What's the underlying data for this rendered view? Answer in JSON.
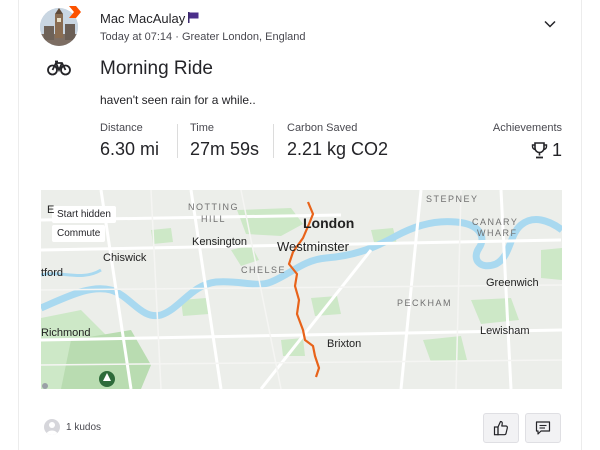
{
  "athlete": {
    "name": "Mac MacAulay",
    "timestamp": "Today at 07:14",
    "location": "Greater London, England",
    "meta_separator": " · "
  },
  "activity": {
    "type_icon": "bike-icon",
    "title": "Morning Ride",
    "description": "haven't seen rain for a while..",
    "stats": [
      {
        "label": "Distance",
        "value": "6.30 mi"
      },
      {
        "label": "Time",
        "value": "27m 59s"
      },
      {
        "label": "Carbon Saved",
        "value": "2.21 kg CO2"
      }
    ],
    "achievements": {
      "label": "Achievements",
      "value": "1",
      "icon": "trophy-icon"
    }
  },
  "map": {
    "tags": [
      "Start hidden",
      "Commute"
    ],
    "partial_letter": "E",
    "labels": {
      "london": "London",
      "westminster": "Westminster",
      "kensington": "Kensington",
      "chiswick": "Chiswick",
      "greenwich": "Greenwich",
      "lewisham": "Lewisham",
      "brixton": "Brixton",
      "richmond": "Richmond",
      "brentford": "tford",
      "notting": "NOTTING",
      "hill": "HILL",
      "chelsea": "CHELSE",
      "stepney": "STEPNEY",
      "canary": "CANARY",
      "wharf": "WHARF",
      "peckham": "PECKHAM"
    },
    "route_color": "#e8631a",
    "water_color": "#a9d9f0",
    "park_color": "#cde8c7"
  },
  "footer": {
    "kudos_text": "1 kudos",
    "like_icon": "thumbs-up-icon",
    "comment_icon": "comment-icon"
  },
  "colors": {
    "brand": "#fc5200",
    "text": "#242428",
    "muted": "#494950"
  }
}
